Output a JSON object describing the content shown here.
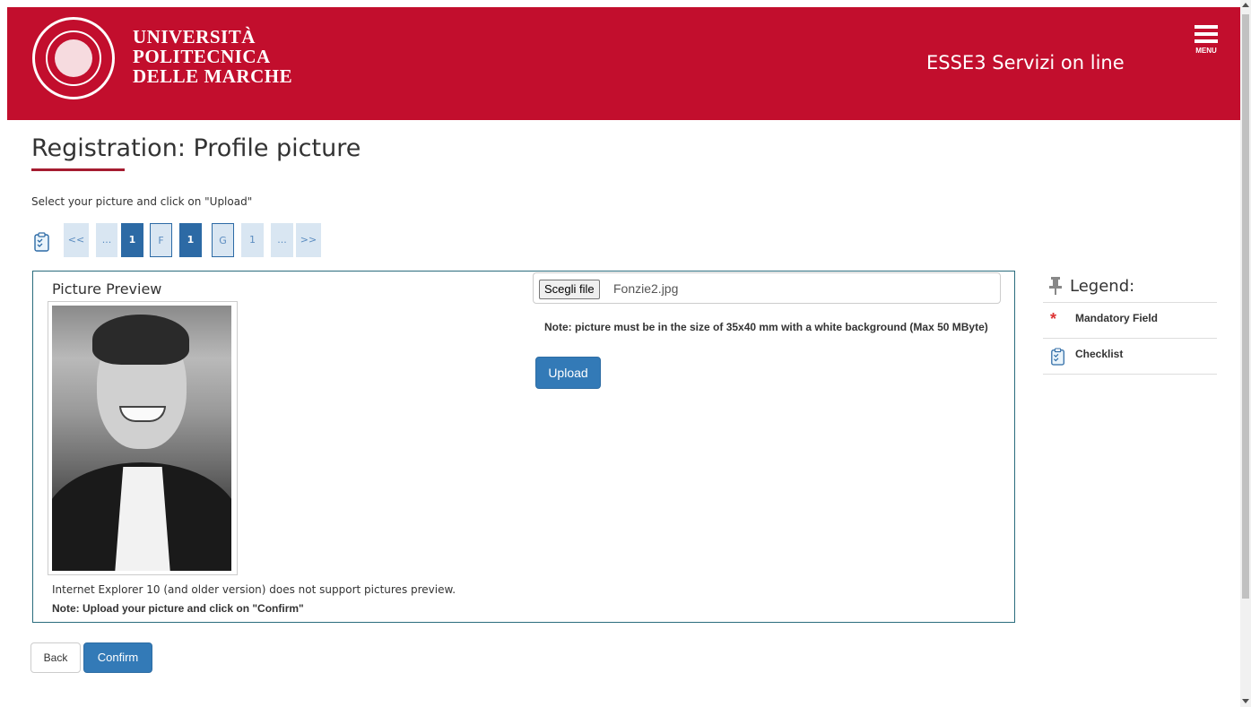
{
  "header": {
    "logo_lines": [
      "UNIVERSITÀ",
      "POLITECNICA",
      "DELLE MARCHE"
    ],
    "service_title": "ESSE3 Servizi on line",
    "menu_label": "MENU",
    "brand_color": "#c20e2d"
  },
  "page": {
    "title": "Registration: Profile picture",
    "instructions": "Select your picture and click on \"Upload\""
  },
  "navigator": {
    "steps": [
      {
        "label": "<<",
        "style": "light"
      },
      {
        "label": "...",
        "style": "light"
      },
      {
        "label": "1",
        "style": "dark"
      },
      {
        "label": "F",
        "style": "outline"
      },
      {
        "label": "1",
        "style": "dark"
      },
      {
        "label": "G",
        "style": "outline"
      },
      {
        "label": "1",
        "style": "light"
      },
      {
        "label": "...",
        "style": "light"
      },
      {
        "label": ">>",
        "style": "light"
      }
    ]
  },
  "upload": {
    "preview_label": "Picture Preview",
    "file_button": "Scegli file",
    "file_name": "Fonzie2.jpg",
    "size_note": "Note: picture must be in the size of 35x40 mm with a white background (Max 50 MByte)",
    "upload_button": "Upload",
    "ie_note": "Internet Explorer 10 (and older version) does not support pictures preview.",
    "confirm_note": "Note: Upload your picture and click on \"Confirm\""
  },
  "legend": {
    "title": "Legend:",
    "items": [
      {
        "icon": "asterisk-icon",
        "label": "Mandatory Field"
      },
      {
        "icon": "checklist-icon",
        "label": "Checklist"
      }
    ]
  },
  "actions": {
    "back": "Back",
    "confirm": "Confirm"
  }
}
